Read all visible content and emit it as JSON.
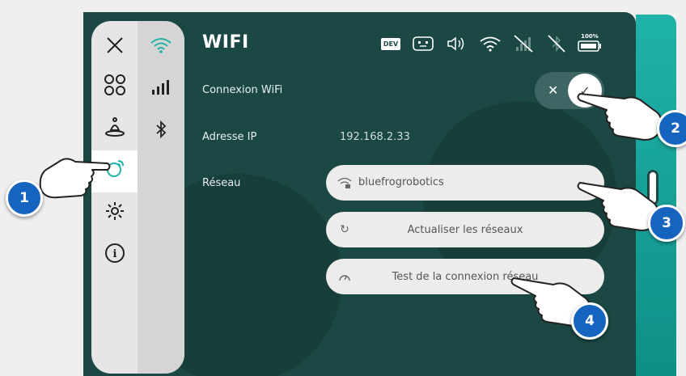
{
  "header": {
    "title": "WIFI"
  },
  "status_icons": [
    "dev-badge",
    "robot-face-icon",
    "volume-icon",
    "wifi-icon",
    "signal-off-icon",
    "bluetooth-off-icon",
    "battery-icon"
  ],
  "status": {
    "dev_label": "DEV",
    "battery_label": "100%"
  },
  "rows": {
    "wifi_label": "Connexion WiFi",
    "ip_label": "Adresse IP",
    "ip_value": "192.168.2.33",
    "network_label": "Réseau"
  },
  "network": {
    "selected": "bluefrogrobotics"
  },
  "buttons": {
    "refresh": "Actualiser les réseaux",
    "test": "Test de la connexion réseau"
  },
  "callouts": [
    "1",
    "2",
    "3",
    "4"
  ],
  "colors": {
    "screen_bg": "#1b4744",
    "accent": "#1fb3a8",
    "badge": "#1565c0"
  }
}
